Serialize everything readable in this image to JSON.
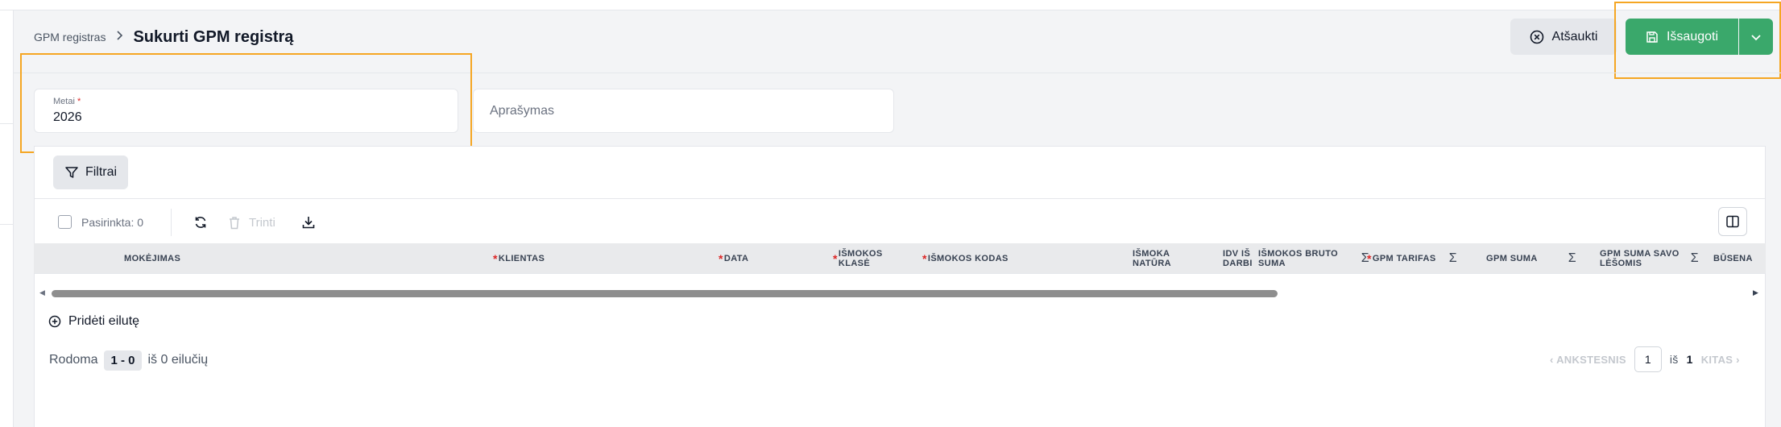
{
  "breadcrumb": {
    "parent": "GPM registras",
    "separator": "›",
    "current": "Sukurti GPM registrą"
  },
  "actions": {
    "cancel_label": "Atšaukti",
    "save_label": "Išsaugoti"
  },
  "form": {
    "metai": {
      "label": "Metai",
      "required_mark": "*",
      "value": "2026"
    },
    "aprasymas": {
      "placeholder": "Aprašymas"
    }
  },
  "filters": {
    "label": "Filtrai"
  },
  "toolbar": {
    "selected_label": "Pasirinkta: 0",
    "delete_label": "Trinti"
  },
  "table": {
    "required_mark": "*",
    "columns": [
      {
        "label": "MOKĖJIMAS",
        "required": false,
        "sigma": false
      },
      {
        "label": "KLIENTAS",
        "required": true,
        "sigma": false
      },
      {
        "label": "DATA",
        "required": true,
        "sigma": false
      },
      {
        "label": "IŠMOKOS KLASĖ",
        "required": true,
        "sigma": false
      },
      {
        "label": "IŠMOKOS KODAS",
        "required": true,
        "sigma": false
      },
      {
        "label": "IŠMOKA NATŪRA",
        "required": false,
        "sigma": false
      },
      {
        "label": "IDV IŠ DARBI",
        "required": false,
        "sigma": false
      },
      {
        "label": "IŠMOKOS BRUTO SUMA",
        "required": false,
        "sigma": true
      },
      {
        "label": "GPM TARIFAS",
        "required": true,
        "sigma": true
      },
      {
        "label": "GPM SUMA",
        "required": false,
        "sigma": true
      },
      {
        "label": "GPM SUMA SAVO LĖŠOMIS",
        "required": false,
        "sigma": true
      },
      {
        "label": "BŪSENA",
        "required": false,
        "sigma": false
      }
    ],
    "sigma_symbol": "Σ",
    "add_row_label": "Pridėti eilutę"
  },
  "pagination": {
    "showing_label": "Rodoma",
    "range": "1 - 0",
    "of_rows": "iš 0 eilučių",
    "prev_label": "ANKSTESNIS",
    "page": "1",
    "of_label": "iš",
    "total_pages": "1",
    "next_label": "KITAS"
  },
  "colors": {
    "accent_green": "#3aa86b",
    "highlight": "#f5a623",
    "required": "#dc2626"
  },
  "icons": [
    "chevron-right-icon",
    "close-circle-icon",
    "save-icon",
    "chevron-down-icon",
    "filter-icon",
    "refresh-icon",
    "trash-icon",
    "download-icon",
    "columns-icon",
    "plus-circle-icon",
    "chevron-left-icon"
  ]
}
